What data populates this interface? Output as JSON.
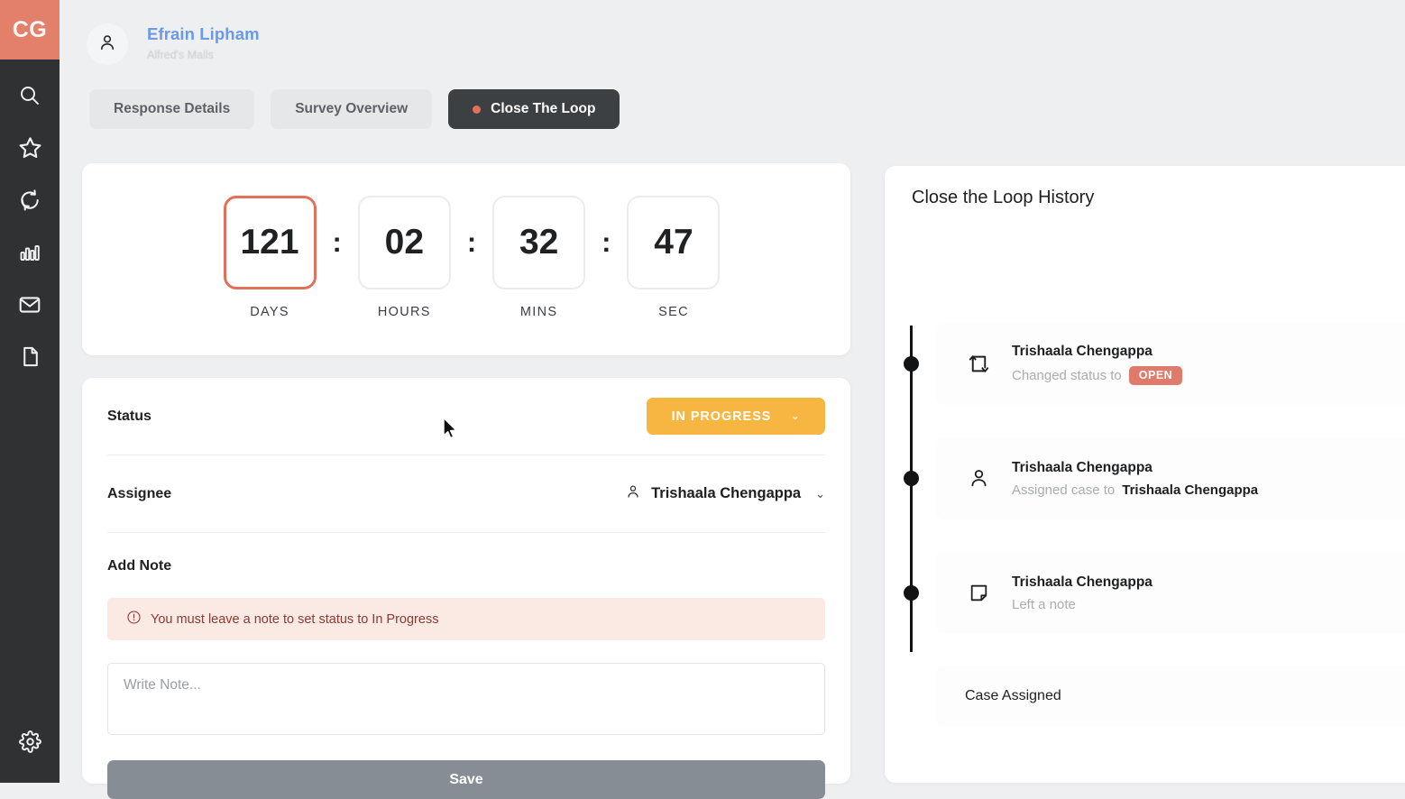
{
  "app": {
    "logo_text": "CG",
    "accent_color": "#e2806c",
    "sidebar_bg": "#2f3133",
    "page_bg": "#eeeff1"
  },
  "sidebar": {
    "items": [
      {
        "icon": "search-icon"
      },
      {
        "icon": "star-icon"
      },
      {
        "icon": "loop-refresh-icon"
      },
      {
        "icon": "bar-chart-icon"
      },
      {
        "icon": "mail-icon"
      },
      {
        "icon": "document-icon"
      }
    ],
    "footer": {
      "icon": "gear-icon"
    }
  },
  "header": {
    "avatar_icon": "person-icon",
    "customer_name": "Efrain Lipham",
    "customer_org": "Alfred's Malls"
  },
  "tabs": [
    {
      "label": "Response Details",
      "active": false
    },
    {
      "label": "Survey Overview",
      "active": false
    },
    {
      "label": "Close The Loop",
      "active": true,
      "dot_color": "#e2715c"
    }
  ],
  "timer": {
    "units": [
      {
        "value": "121",
        "label": "DAYS",
        "highlighted": true
      },
      {
        "value": "02",
        "label": "HOURS",
        "highlighted": false
      },
      {
        "value": "32",
        "label": "MINS",
        "highlighted": false
      },
      {
        "value": "47",
        "label": "SEC",
        "highlighted": false
      }
    ],
    "separator": ":"
  },
  "form": {
    "status_label": "Status",
    "status_value": "IN PROGRESS",
    "status_color": "#f7b541",
    "status_chevron": "⌄",
    "assignee_label": "Assignee",
    "assignee_value": "Trishaala Chengappa",
    "assignee_chevron": "⌄",
    "note_label": "Add Note",
    "error_message": "You must leave a note to set status to In Progress",
    "error_icon": "exclamation-circle-icon",
    "note_placeholder": "Write Note...",
    "note_value": "",
    "save_label": "Save"
  },
  "history": {
    "title": "Close the Loop History",
    "items": [
      {
        "icon": "status-change-icon",
        "name": "Trishaala Chengappa",
        "desc_prefix": "Changed status to",
        "badge": "OPEN",
        "badge_color": "#e07a6a",
        "desc_suffix": ""
      },
      {
        "icon": "person-icon",
        "name": "Trishaala Chengappa",
        "desc_prefix": "Assigned case to",
        "badge": "",
        "badge_color": "",
        "desc_suffix": "Trishaala Chengappa"
      },
      {
        "icon": "note-icon",
        "name": "Trishaala Chengappa",
        "desc_prefix": "Left a note",
        "badge": "",
        "badge_color": "",
        "desc_suffix": ""
      }
    ],
    "footer_item": "Case Assigned"
  }
}
